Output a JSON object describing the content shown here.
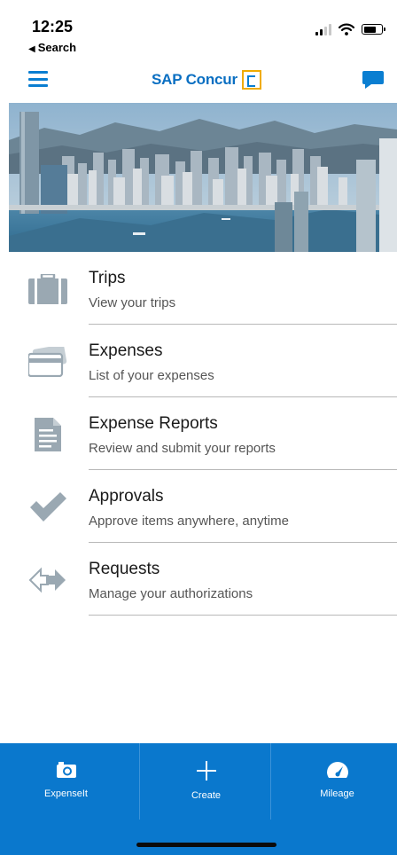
{
  "status_bar": {
    "time": "12:25",
    "back_app_label": "Search"
  },
  "header": {
    "brand": "SAP Concur",
    "colors": {
      "brand_blue": "#0a6fc2",
      "logo_gold": "#f0ab00"
    }
  },
  "hero": {
    "icon": "city-skyline-image"
  },
  "menu": {
    "items": [
      {
        "title": "Trips",
        "subtitle": "View your trips",
        "icon": "briefcase-icon"
      },
      {
        "title": "Expenses",
        "subtitle": "List of your expenses",
        "icon": "credit-card-icon"
      },
      {
        "title": "Expense Reports",
        "subtitle": "Review and submit your reports",
        "icon": "document-icon"
      },
      {
        "title": "Approvals",
        "subtitle": "Approve items anywhere, anytime",
        "icon": "checkmark-icon"
      },
      {
        "title": "Requests",
        "subtitle": "Manage your authorizations",
        "icon": "arrows-exchange-icon"
      }
    ]
  },
  "bottom_nav": {
    "tabs": [
      {
        "label": "ExpenseIt",
        "icon": "camera-icon"
      },
      {
        "label": "Create",
        "icon": "plus-icon"
      },
      {
        "label": "Mileage",
        "icon": "speedometer-icon"
      }
    ],
    "colors": {
      "bar": "#0a78cd"
    }
  }
}
